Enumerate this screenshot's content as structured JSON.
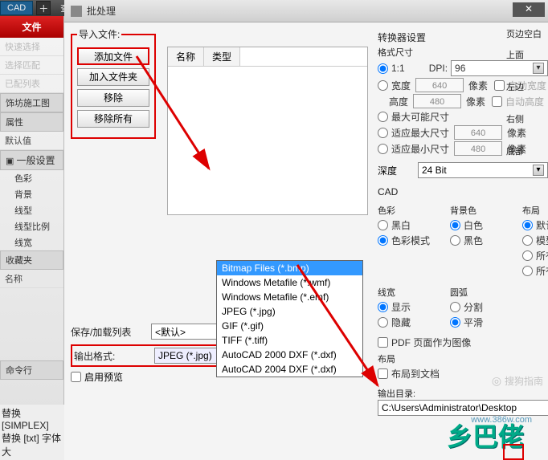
{
  "topbar": {
    "cad": "CAD",
    "find": "查看"
  },
  "dialog": {
    "title": "批处理",
    "close": "✕"
  },
  "sidebar": {
    "file_tab": "文件",
    "items": [
      "快速选择",
      "选择匹配",
      "已配列表"
    ],
    "section1": "饰坊施工图",
    "attr": "属性",
    "default": "默认值",
    "general": "一般设置",
    "subs": [
      "色彩",
      "背景",
      "线型",
      "线型比例",
      "线宽"
    ],
    "fav": "收藏夹",
    "name": "名称",
    "cmd": "命令行"
  },
  "import_group": {
    "legend": "导入文件:",
    "add_file": "添加文件",
    "add_folder": "加入文件夹",
    "remove": "移除",
    "remove_all": "移除所有"
  },
  "list": {
    "col_name": "名称",
    "col_type": "类型"
  },
  "save_load": {
    "label": "保存/加载列表",
    "value": "<默认>"
  },
  "output_format": {
    "label": "输出格式:",
    "value": "JPEG (*.jpg)"
  },
  "format_options": [
    "Bitmap Files (*.bmp)",
    "Windows Metafile (*.wmf)",
    "Windows Metafile (*.emf)",
    "JPEG (*.jpg)",
    "GIF (*.gif)",
    "TIFF (*.tiff)",
    "AutoCAD 2000 DXF (*.dxf)",
    "AutoCAD 2004 DXF (*.dxf)"
  ],
  "use_preview": "启用预览",
  "converter": {
    "title": "转换器设置",
    "format_size": "格式尺寸",
    "one_to_one": "1:1",
    "dpi_label": "DPI:",
    "dpi_value": "96",
    "width_label": "宽度",
    "width_value": "640",
    "px": "像素",
    "auto_width": "自动宽度",
    "height_label": "高度",
    "height_value": "480",
    "auto_height": "自动高度",
    "max_possible": "最大可能尺寸",
    "fit_max": "适应最大尺寸",
    "fit_max_v": "640",
    "fit_min": "适应最小尺寸",
    "fit_min_v": "480",
    "depth_label": "深度",
    "depth_value": "24 Bit"
  },
  "margins": {
    "title": "页边空白",
    "top": "上面",
    "left": "左边",
    "right": "右侧",
    "bottom": "底部"
  },
  "cad": {
    "title": "CAD",
    "color": "色彩",
    "bw": "黑白",
    "color_mode": "色彩模式",
    "bg": "背景色",
    "white": "白色",
    "black": "黑色",
    "layout": "布局",
    "default": "默认",
    "model": "模型",
    "all_layout": "所有布局",
    "all_layout_p": "所有布局+",
    "arc": "线宽",
    "show": "显示",
    "hide": "隐藏",
    "arc2": "圆弧",
    "split": "分割",
    "smooth": "平滑",
    "pdf_as_img": "PDF 页面作为图像",
    "layout2": "布局",
    "layout_to_doc": "布局到文档"
  },
  "output_dir": {
    "label": "输出目录:",
    "value": "C:\\Users\\Administrator\\Desktop"
  },
  "history": [
    "替换 [SIMPLEX]",
    "替换 [txt] 字体大"
  ],
  "watermarks": {
    "w1": "搜狗指南",
    "w2": "乡巴佬",
    "w3": "www.386w.com"
  }
}
